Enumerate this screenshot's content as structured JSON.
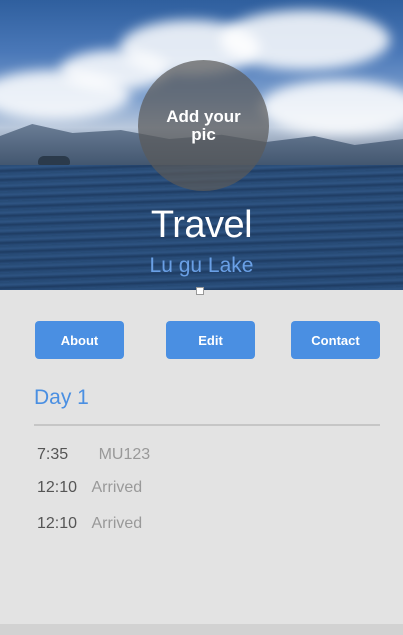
{
  "hero": {
    "avatar_prompt": "Add your pic",
    "title": "Travel",
    "subtitle": "Lu gu Lake"
  },
  "buttons": {
    "about": "About",
    "edit": "Edit",
    "contact": "Contact"
  },
  "itinerary": {
    "day_label": "Day 1",
    "entries": [
      {
        "time": "7:35",
        "detail": "MU123"
      },
      {
        "time": "12:10",
        "detail": "Arrived"
      },
      {
        "time": "12:10",
        "detail": "Arrived"
      }
    ]
  },
  "colors": {
    "accent": "#4a8fe2",
    "subtitle": "#6aa0e6",
    "background": "#e3e3e3"
  }
}
